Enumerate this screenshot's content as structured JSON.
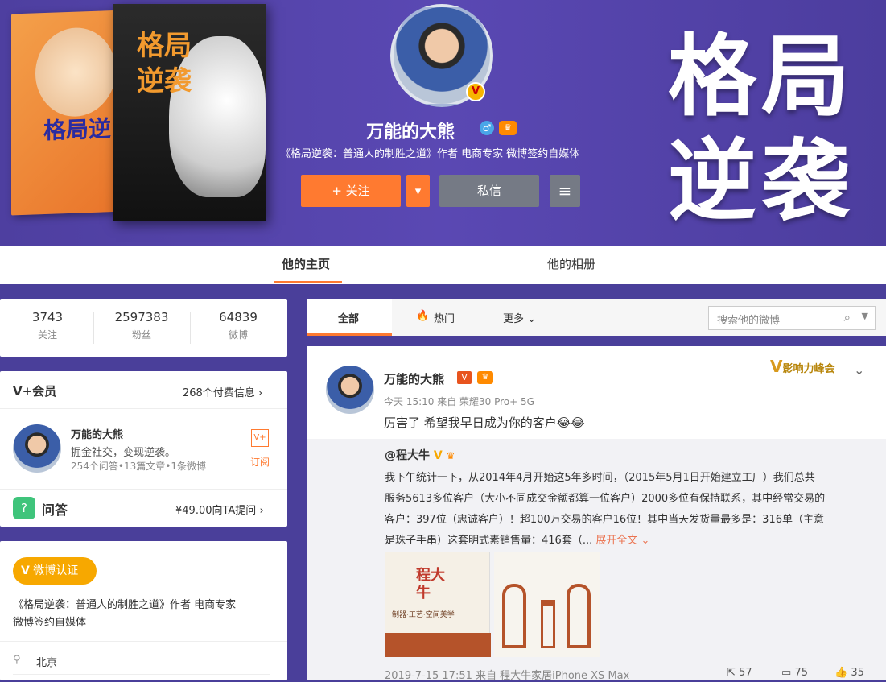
{
  "banner": {
    "cover_title_line1": "格局",
    "cover_title_line2": "逆袭",
    "book1_title": "格局逆",
    "book2_title": "格局逆袭"
  },
  "profile": {
    "name": "万能的大熊",
    "gender_icon": "♂",
    "description": "《格局逆袭：普通人的制胜之道》作者 电商专家 微博签约自媒体",
    "follow_label": "+ 关注",
    "message_label": "私信"
  },
  "tabs": [
    {
      "label": "他的主页"
    },
    {
      "label": "他的相册"
    }
  ],
  "stats": [
    {
      "value": "3743",
      "label": "关注"
    },
    {
      "value": "2597383",
      "label": "粉丝"
    },
    {
      "value": "64839",
      "label": "微博"
    }
  ],
  "vplus": {
    "title": "V+会员",
    "paid_info": "268个付费信息",
    "member_name": "万能的大熊",
    "member_slogan": "掘金社交，变现逆袭。",
    "member_stats": "254个问答•13篇文章•1条微博",
    "subscribe_label": "订阅"
  },
  "qa": {
    "title": "问答",
    "price": "¥49.00向TA提问"
  },
  "verify": {
    "badge": "微博认证",
    "line1": "《格局逆袭：普通人的制胜之道》作者 电商专家",
    "line2": "微博签约自媒体",
    "location": "北京"
  },
  "feed_tabs": {
    "all": "全部",
    "hot": "热门",
    "more": "更多",
    "search_placeholder": "搜索他的微博"
  },
  "post": {
    "author": "万能的大熊",
    "meta": "今天 15:10 来自 荣耀30 Pro+ 5G",
    "text": "厉害了 希望我早日成为你的客户",
    "summit_badge": "影响力峰会",
    "repost": {
      "author": "@程大牛",
      "text_lines": [
        "我下午统计一下，从2014年4月开始这5年多时间，（2015年5月1日开始建立工厂）我们总共",
        "服务5613多位客户（大小不同成交金额都算一位客户）2000多位有保持联系，其中经常交易的",
        "客户：397位（忠诚客户）！超100万交易的客户16位！其中当天发货量最多是：316单（主意",
        "是珠子手串）这套明式素销售量：416套（..."
      ],
      "expand_label": "展开全文",
      "img1_text": "程大牛",
      "img1_sub": "制器·工艺·空间美学",
      "meta": "2019-7-15 17:51 来自 程大牛家居iPhone XS Max",
      "forward_count": "57",
      "comment_count": "75",
      "like_count": "35"
    }
  }
}
